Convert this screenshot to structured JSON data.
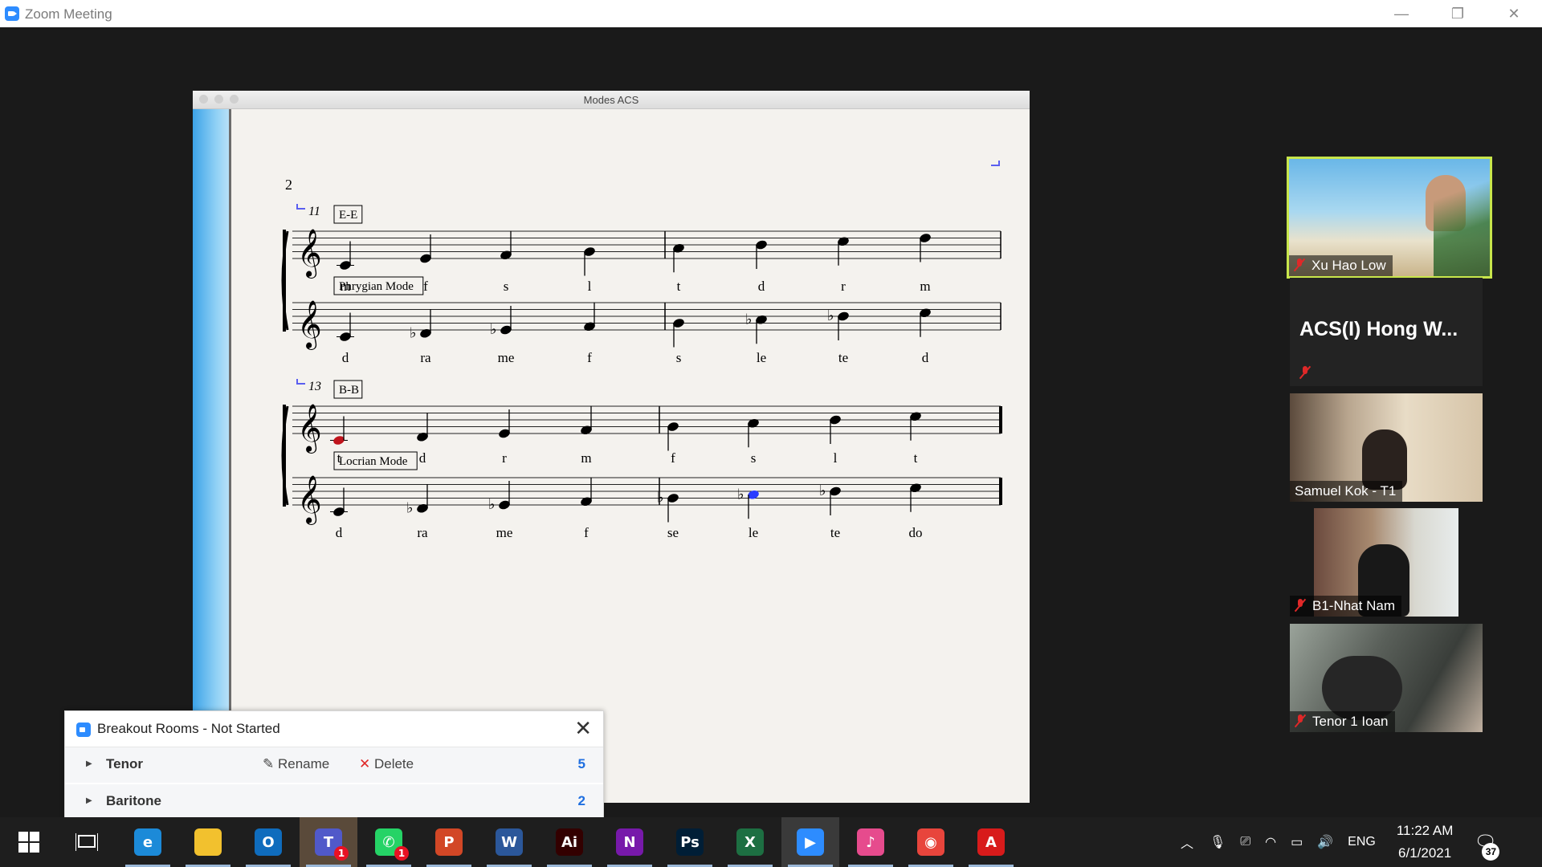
{
  "window": {
    "title": "Zoom Meeting",
    "minimize": "—",
    "restore": "❐",
    "close": "✕"
  },
  "score": {
    "window_title": "Modes ACS",
    "page_number": "2",
    "systems": [
      {
        "measure": "11",
        "staves": [
          {
            "box": "E-E",
            "syllables": [
              "m",
              "f",
              "s",
              "l",
              "t",
              "d",
              "r",
              "m"
            ]
          },
          {
            "box": "Phrygian Mode",
            "syllables": [
              "d",
              "ra",
              "me",
              "f",
              "s",
              "le",
              "te",
              "d"
            ]
          }
        ]
      },
      {
        "measure": "13",
        "staves": [
          {
            "box": "B-B",
            "syllables": [
              "t",
              "d",
              "r",
              "m",
              "f",
              "s",
              "l",
              "t"
            ]
          },
          {
            "box": "Locrian Mode",
            "syllables": [
              "d",
              "ra",
              "me",
              "f",
              "se",
              "le",
              "te",
              "do"
            ]
          }
        ]
      }
    ],
    "colors": {
      "highlight_red": "#c0141c",
      "highlight_blue": "#2a3cff",
      "cue": "#5a5ef0"
    }
  },
  "breakout": {
    "title": "Breakout Rooms - Not Started",
    "close": "✕",
    "rename_label": "Rename",
    "delete_label": "Delete",
    "rooms": [
      {
        "name": "Tenor",
        "count": "5"
      },
      {
        "name": "Baritone",
        "count": "2"
      }
    ]
  },
  "participants": [
    {
      "name": "Xu Hao Low",
      "active_speaker": true
    },
    {
      "name": "ACS(I) Hong W..."
    },
    {
      "name": "Samuel Kok - T1"
    },
    {
      "name": "B1-Nhat Nam"
    },
    {
      "name": "Tenor 1 Ioan"
    }
  ],
  "taskbar": {
    "apps": [
      {
        "name": "edge-icon",
        "label": "e",
        "color": "#1c8ad8"
      },
      {
        "name": "file-explorer-icon",
        "label": "",
        "color": "#f2c12e"
      },
      {
        "name": "outlook-icon",
        "label": "O",
        "color": "#0f6cbd"
      },
      {
        "name": "teams-icon",
        "label": "T",
        "color": "#5059c9",
        "badge": "1",
        "active": true
      },
      {
        "name": "whatsapp-icon",
        "label": "✆",
        "color": "#25d366",
        "badge": "1"
      },
      {
        "name": "powerpoint-icon",
        "label": "P",
        "color": "#d24726"
      },
      {
        "name": "word-icon",
        "label": "W",
        "color": "#2b579a"
      },
      {
        "name": "illustrator-icon",
        "label": "Ai",
        "color": "#330000"
      },
      {
        "name": "onenote-icon",
        "label": "N",
        "color": "#7719aa"
      },
      {
        "name": "photoshop-icon",
        "label": "Ps",
        "color": "#001e36"
      },
      {
        "name": "excel-icon",
        "label": "X",
        "color": "#1d6f42"
      },
      {
        "name": "zoom-icon",
        "label": "▶",
        "color": "#2d8cff",
        "active": true
      },
      {
        "name": "itunes-icon",
        "label": "♪",
        "color": "#e64b8d"
      },
      {
        "name": "chrome-icon",
        "label": "◉",
        "color": "#e8453c"
      },
      {
        "name": "acrobat-icon",
        "label": "A",
        "color": "#d81b1b"
      }
    ],
    "tray": {
      "language": "ENG",
      "time": "11:22 AM",
      "date": "6/1/2021",
      "notifications": "37"
    }
  }
}
